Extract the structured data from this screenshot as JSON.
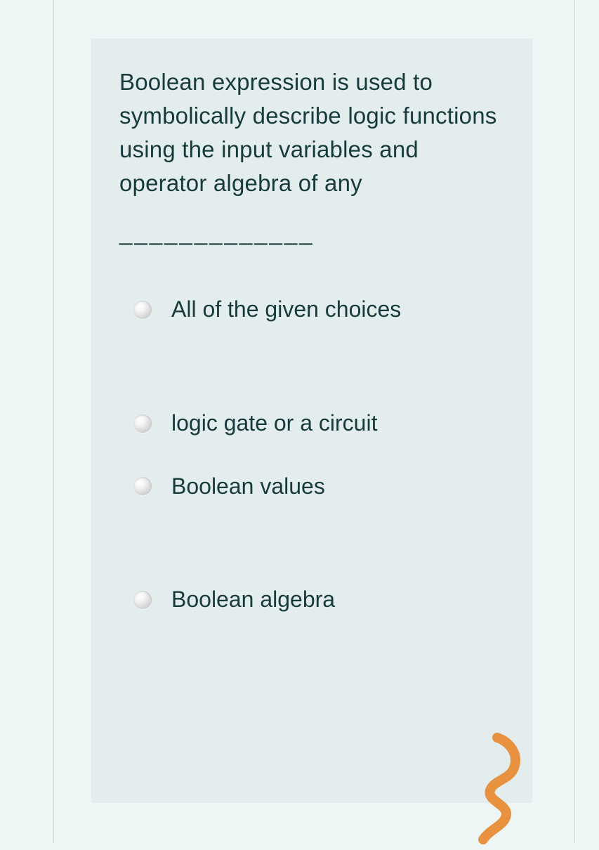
{
  "question": {
    "text": "Boolean expression is used to symbolically describe logic functions using the input variables and operator algebra of any",
    "blank": "_____________"
  },
  "options": [
    {
      "label": "All of the given choices"
    },
    {
      "label": "logic gate or a circuit"
    },
    {
      "label": "Boolean values"
    },
    {
      "label": "Boolean algebra"
    }
  ]
}
